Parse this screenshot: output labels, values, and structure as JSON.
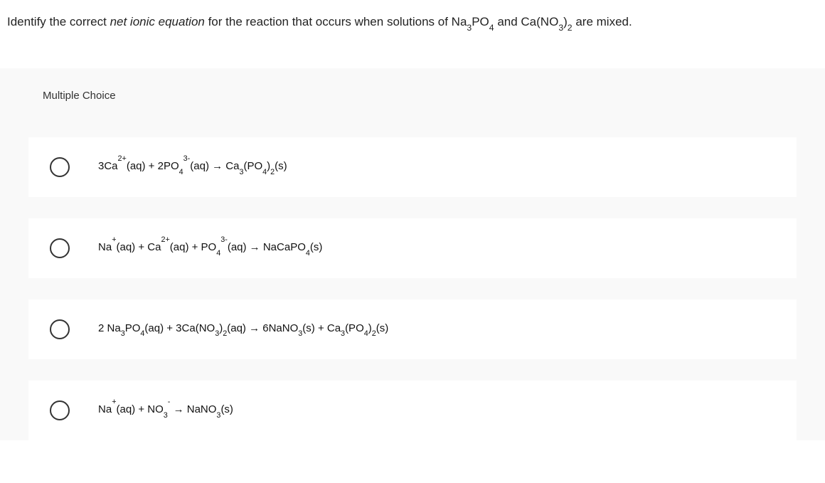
{
  "question": {
    "prefix": "Identify the correct ",
    "italic": "net ionic equation",
    "suffix_before_formula": " for the reaction that occurs when solutions of ",
    "formula1_pre": "Na",
    "formula1_sub1": "3",
    "formula1_mid": "PO",
    "formula1_sub2": "4",
    "between": " and ",
    "formula2_pre": "Ca(NO",
    "formula2_sub1": "3",
    "formula2_mid": ")",
    "formula2_sub2": "2",
    "suffix_end": " are mixed."
  },
  "section_label": "Multiple Choice",
  "choices": {
    "a": {
      "p1": "3Ca",
      "s1": "2+",
      "p2": "(aq) + 2PO",
      "sub2": "4",
      "s3": "3-",
      "p3": "(aq) → Ca",
      "sub4": "3",
      "p4": "(PO",
      "sub5": "4",
      "p5": ")",
      "sub6": "2",
      "p6": "(s)"
    },
    "b": {
      "p1": "Na",
      "s1": "+",
      "p2": "(aq) + Ca",
      "s2": "2+",
      "p3": "(aq) + PO",
      "sub3": "4",
      "s4": "3-",
      "p4": "(aq) → NaCaPO",
      "sub5": "4",
      "p5": "(s)"
    },
    "c": {
      "p1": "2 Na",
      "sub1": "3",
      "p2": "PO",
      "sub2": "4",
      "p3": "(aq) + 3Ca(NO",
      "sub3": "3",
      "p4": ")",
      "sub4": "2",
      "p5": "(aq) → 6NaNO",
      "sub5": "3",
      "p6": "(s) + Ca",
      "sub6": "3",
      "p7": "(PO",
      "sub7": "4",
      "p8": ")",
      "sub8": "2",
      "p9": "(s)"
    },
    "d": {
      "p1": "Na",
      "s1": "+",
      "p2": "(aq) + NO",
      "sub1": "3",
      "s2": "-",
      "p3": " → NaNO",
      "sub2": "3",
      "p4": "(s)"
    }
  }
}
